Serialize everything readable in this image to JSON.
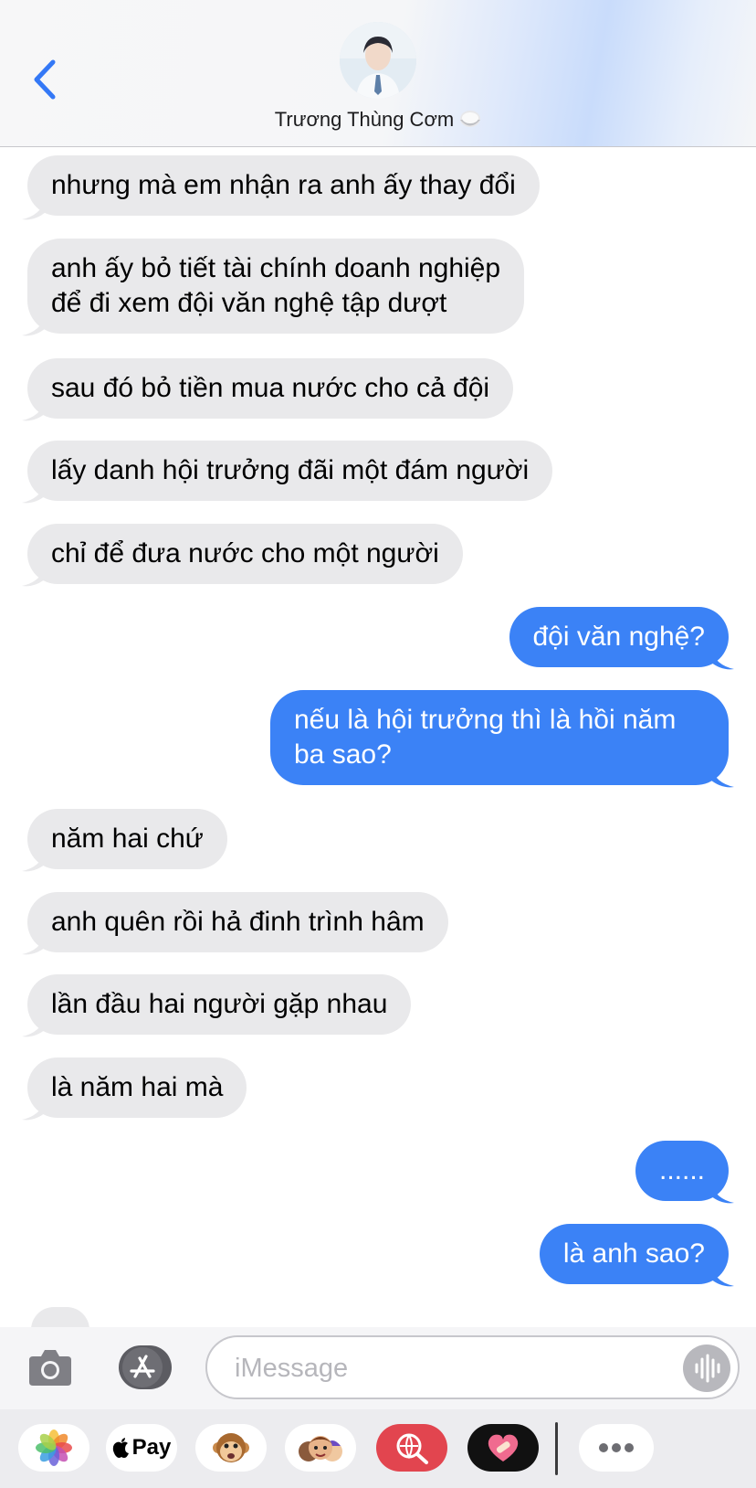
{
  "header": {
    "contact_name": "Trương Thùng Cơm"
  },
  "messages": [
    {
      "from": "them",
      "text": "nhưng mà em nhận ra anh ấy thay đổi"
    },
    {
      "from": "them",
      "text": "anh ấy bỏ tiết tài chính doanh nghiệp\nđể đi xem đội văn nghệ tập dượt"
    },
    {
      "from": "them",
      "text": "sau đó bỏ tiền mua nước cho cả đội"
    },
    {
      "from": "them",
      "text": "lấy danh hội trưởng đãi một đám người"
    },
    {
      "from": "them",
      "text": "chỉ để đưa nước cho một người"
    },
    {
      "from": "me",
      "text": "đội văn nghệ?"
    },
    {
      "from": "me",
      "text": "nếu là hội trưởng thì là hồi năm\nba sao?"
    },
    {
      "from": "them",
      "text": "năm hai chứ"
    },
    {
      "from": "them",
      "text": "anh quên rồi hả đinh trình hâm"
    },
    {
      "from": "them",
      "text": "lần đầu hai người gặp nhau"
    },
    {
      "from": "them",
      "text": "là năm hai mà"
    },
    {
      "from": "me",
      "text": "......"
    },
    {
      "from": "me",
      "text": "là anh sao?"
    }
  ],
  "input": {
    "placeholder": "iMessage"
  },
  "apps": {
    "pay_label": "Pay"
  },
  "colors": {
    "outgoing_bubble": "#3b82f6",
    "incoming_bubble": "#e9e9eb",
    "accent": "#3478f6"
  },
  "icons": [
    "back-chevron-icon",
    "camera-icon",
    "app-store-icon",
    "waveform-icon",
    "photos-icon",
    "apple-icon",
    "monkey-memoji-icon",
    "memoji-stickers-icon",
    "image-search-icon",
    "heart-bandage-icon",
    "more-icon"
  ]
}
